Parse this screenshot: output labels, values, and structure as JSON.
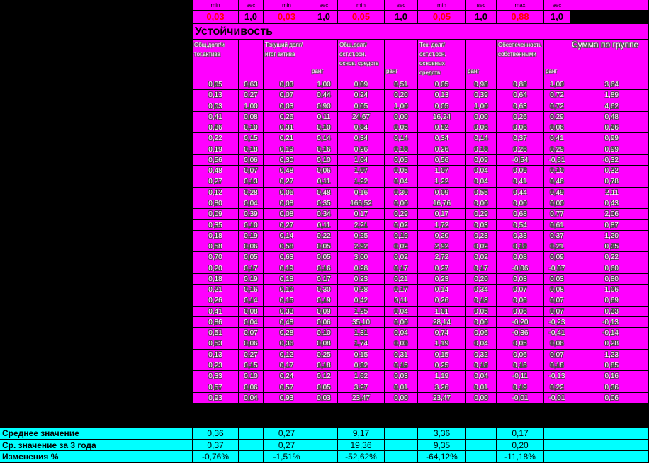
{
  "top": {
    "labels": [
      "min",
      "вес",
      "min",
      "вес",
      "min",
      "вес",
      "min",
      "вес",
      "max",
      "вес"
    ],
    "values": [
      "0,03",
      "1,0",
      "0,03",
      "1,0",
      "0,05",
      "1,0",
      "0,05",
      "1,0",
      "0,88",
      "1,0"
    ]
  },
  "section_title": "Устойчивость",
  "headers": [
    "Общ.долг/и тог.актива",
    "",
    "Текущий долг/ итог актива",
    "ранг",
    "Общ.долг/ ост.ст.осн. основ. средств",
    "ранг",
    "Тек. долг/ ост.ст.осн. основных средств",
    "ранг",
    "Обеспеченность собственными",
    "ранг",
    "Сумма по группе"
  ],
  "rows": [
    [
      "0,05",
      "0,63",
      "0,03",
      "1,00",
      "0,09",
      "0,51",
      "0,05",
      "0,98",
      "0,88",
      "1,00",
      "3,64"
    ],
    [
      "0,13",
      "0,27",
      "0,07",
      "0,44",
      "0,24",
      "0,20",
      "0,13",
      "0,39",
      "0,64",
      "0,72",
      "1,89"
    ],
    [
      "0,03",
      "1,00",
      "0,03",
      "0,90",
      "0,05",
      "1,00",
      "0,05",
      "1,00",
      "0,63",
      "0,72",
      "4,62"
    ],
    [
      "0,41",
      "0,08",
      "0,26",
      "0,11",
      "24,67",
      "0,00",
      "16,24",
      "0,00",
      "0,26",
      "0,29",
      "0,48"
    ],
    [
      "0,36",
      "0,10",
      "0,31",
      "0,10",
      "0,84",
      "0,05",
      "0,82",
      "0,06",
      "0,06",
      "0,06",
      "0,36"
    ],
    [
      "0,22",
      "0,15",
      "0,21",
      "0,14",
      "0,34",
      "0,14",
      "0,34",
      "0,14",
      "0,37",
      "0,41",
      "0,99"
    ],
    [
      "0,19",
      "0,18",
      "0,19",
      "0,16",
      "0,26",
      "0,18",
      "0,26",
      "0,18",
      "0,26",
      "0,29",
      "0,99"
    ],
    [
      "0,56",
      "0,06",
      "0,30",
      "0,10",
      "1,04",
      "0,05",
      "0,56",
      "0,09",
      "-0,54",
      "-0,61",
      "-0,32"
    ],
    [
      "0,48",
      "0,07",
      "0,48",
      "0,06",
      "1,07",
      "0,05",
      "1,07",
      "0,04",
      "0,09",
      "0,10",
      "0,32"
    ],
    [
      "0,27",
      "0,13",
      "0,27",
      "0,11",
      "1,22",
      "0,04",
      "1,22",
      "0,04",
      "0,41",
      "0,46",
      "0,78"
    ],
    [
      "0,12",
      "0,28",
      "0,06",
      "0,48",
      "0,16",
      "0,30",
      "0,09",
      "0,55",
      "0,44",
      "0,49",
      "2,11"
    ],
    [
      "0,80",
      "0,04",
      "0,08",
      "0,35",
      "166,52",
      "0,00",
      "16,76",
      "0,00",
      "0,00",
      "0,00",
      "0,43"
    ],
    [
      "0,09",
      "0,39",
      "0,08",
      "0,34",
      "0,17",
      "0,29",
      "0,17",
      "0,29",
      "0,68",
      "0,77",
      "2,06"
    ],
    [
      "0,35",
      "0,10",
      "0,27",
      "0,11",
      "2,21",
      "0,02",
      "1,72",
      "0,03",
      "0,54",
      "0,61",
      "0,87"
    ],
    [
      "0,18",
      "0,19",
      "0,14",
      "0,22",
      "0,25",
      "0,19",
      "0,20",
      "0,23",
      "0,33",
      "0,37",
      "1,20"
    ],
    [
      "0,58",
      "0,06",
      "0,58",
      "0,05",
      "2,92",
      "0,02",
      "2,92",
      "0,02",
      "0,18",
      "0,21",
      "0,35"
    ],
    [
      "0,70",
      "0,05",
      "0,63",
      "0,05",
      "3,00",
      "0,02",
      "2,72",
      "0,02",
      "0,08",
      "0,09",
      "0,22"
    ],
    [
      "0,20",
      "0,17",
      "0,19",
      "0,16",
      "0,28",
      "0,17",
      "0,27",
      "0,17",
      "-0,06",
      "-0,07",
      "0,60"
    ],
    [
      "0,18",
      "0,19",
      "0,18",
      "0,17",
      "0,23",
      "0,21",
      "0,23",
      "0,20",
      "0,03",
      "0,03",
      "0,80"
    ],
    [
      "0,21",
      "0,16",
      "0,10",
      "0,30",
      "0,28",
      "0,17",
      "0,14",
      "0,34",
      "0,07",
      "0,08",
      "1,06"
    ],
    [
      "0,26",
      "0,14",
      "0,15",
      "0,19",
      "0,42",
      "0,11",
      "0,26",
      "0,18",
      "0,06",
      "0,07",
      "0,69"
    ],
    [
      "0,41",
      "0,08",
      "0,33",
      "0,09",
      "1,25",
      "0,04",
      "1,01",
      "0,05",
      "0,06",
      "0,07",
      "0,33"
    ],
    [
      "0,86",
      "0,04",
      "0,48",
      "0,06",
      "35,10",
      "0,00",
      "28,14",
      "0,00",
      "-0,20",
      "-0,23",
      "-0,13"
    ],
    [
      "0,51",
      "0,07",
      "0,28",
      "0,10",
      "1,31",
      "0,04",
      "0,74",
      "0,06",
      "-0,36",
      "-0,41",
      "-0,14"
    ],
    [
      "0,53",
      "0,06",
      "0,36",
      "0,08",
      "1,74",
      "0,03",
      "1,19",
      "0,04",
      "0,05",
      "0,06",
      "0,28"
    ],
    [
      "0,13",
      "0,27",
      "0,12",
      "0,25",
      "0,15",
      "0,31",
      "0,15",
      "0,32",
      "0,06",
      "0,07",
      "1,23"
    ],
    [
      "0,23",
      "0,15",
      "0,17",
      "0,18",
      "0,32",
      "0,15",
      "0,25",
      "0,18",
      "0,16",
      "0,18",
      "0,85"
    ],
    [
      "0,33",
      "0,10",
      "0,24",
      "0,12",
      "1,62",
      "0,03",
      "1,19",
      "0,04",
      "-0,11",
      "-0,13",
      "0,16"
    ],
    [
      "0,57",
      "0,06",
      "0,57",
      "0,05",
      "3,27",
      "0,01",
      "3,26",
      "0,01",
      "0,19",
      "0,22",
      "0,36"
    ],
    [
      "0,93",
      "0,04",
      "0,93",
      "0,03",
      "23,47",
      "0,00",
      "23,47",
      "0,00",
      "-0,01",
      "-0,01",
      "0,06"
    ]
  ],
  "footer": [
    {
      "label": "Среднее значение",
      "values": [
        "0,36",
        "0,27",
        "9,17",
        "3,36",
        "0,17"
      ]
    },
    {
      "label": "Ср. значение за 3 года",
      "values": [
        "0,37",
        "0,27",
        "19,36",
        "9,35",
        "0,20"
      ]
    },
    {
      "label": "Изменения  %",
      "values": [
        "-0,76%",
        "-1,51%",
        "-52,62%",
        "-64,12%",
        "-11,18%"
      ]
    }
  ]
}
